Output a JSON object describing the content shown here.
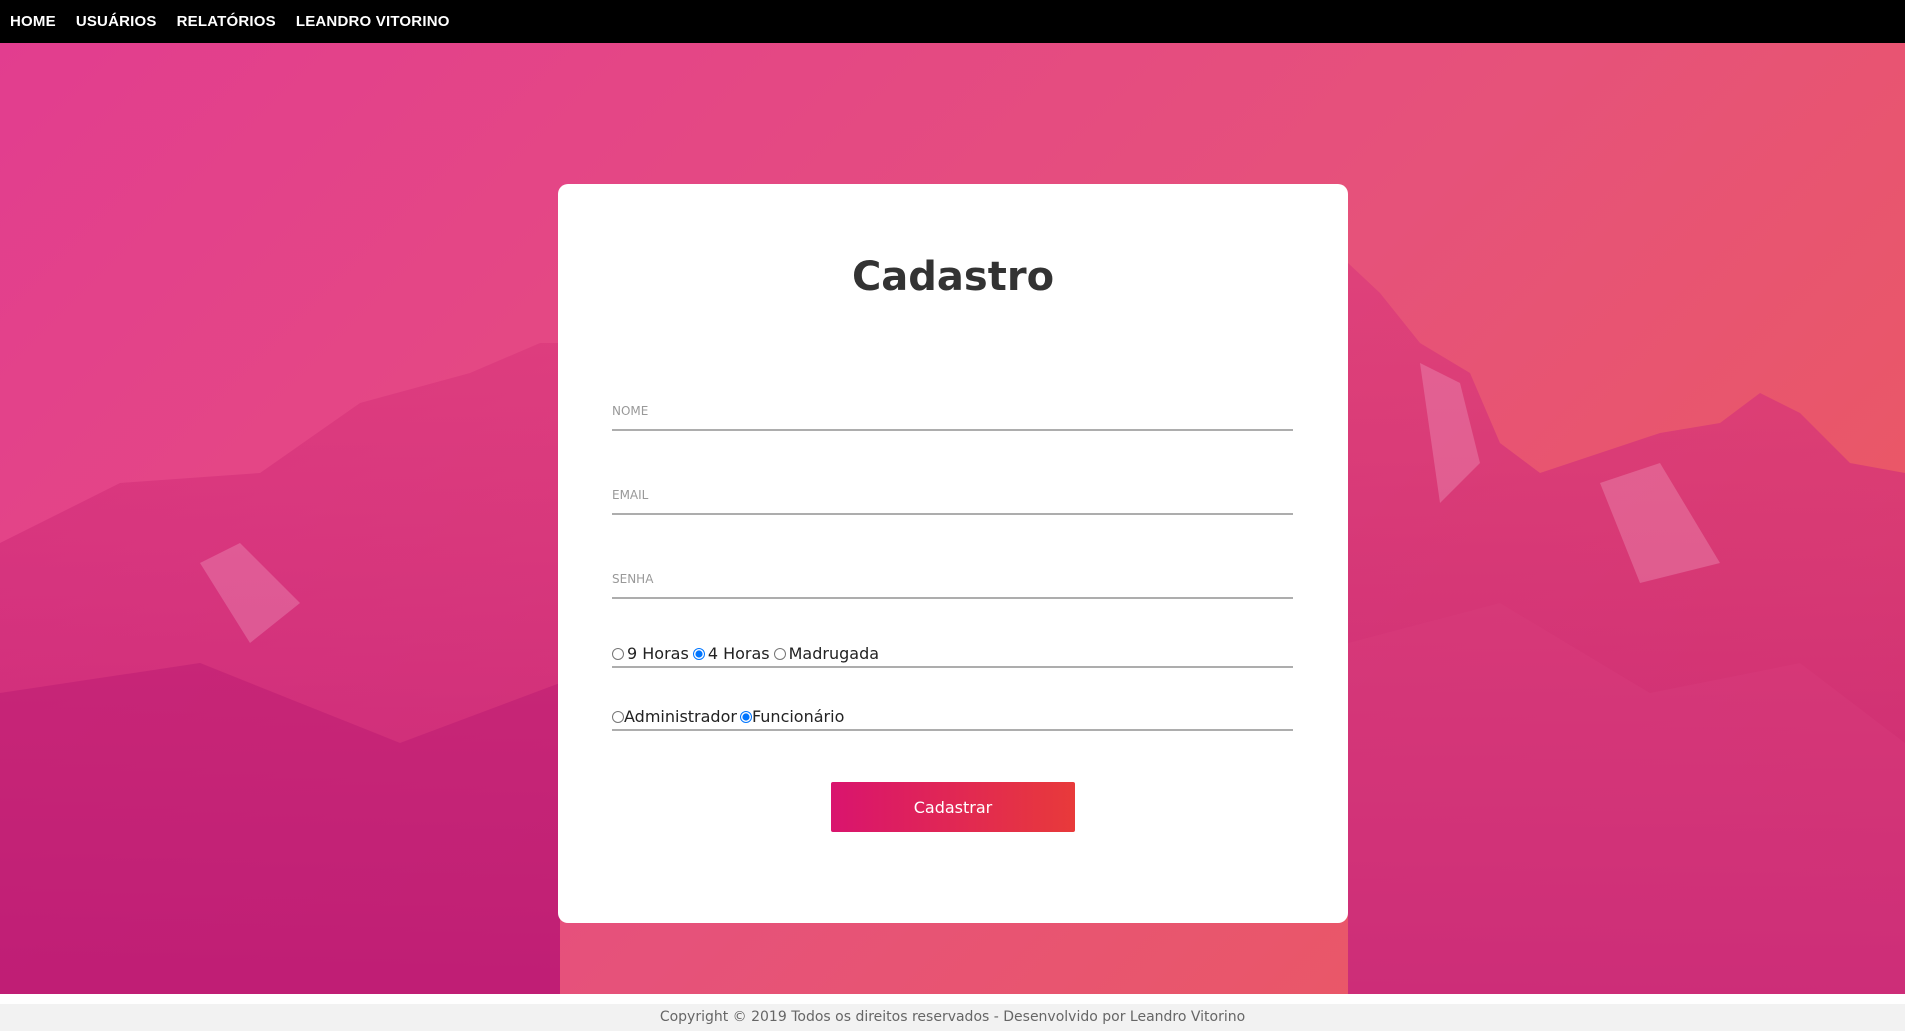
{
  "nav": {
    "items": [
      {
        "label": "HOME"
      },
      {
        "label": "USUÁRIOS"
      },
      {
        "label": "RELATÓRIOS"
      },
      {
        "label": "LEANDRO VITORINO"
      }
    ]
  },
  "form": {
    "title": "Cadastro",
    "nome_placeholder": "NOME",
    "email_placeholder": "EMAIL",
    "senha_placeholder": "SENHA",
    "turno": {
      "options": [
        {
          "label": "9 Horas",
          "checked": false
        },
        {
          "label": "4 Horas",
          "checked": true
        },
        {
          "label": "Madrugada",
          "checked": false
        }
      ]
    },
    "perfil": {
      "options": [
        {
          "label": "Administrador",
          "checked": false
        },
        {
          "label": "Funcionário",
          "checked": true
        }
      ]
    },
    "submit_label": "Cadastrar"
  },
  "footer": {
    "text": "Copyright © 2019 Todos os direitos reservados - Desenvolvido por Leandro Vitorino"
  },
  "colors": {
    "nav_bg": "#000000",
    "button_start": "#d9146e",
    "button_end": "#e83a3a",
    "hero_start": "#e23d8f",
    "hero_end": "#ec5b5b"
  }
}
